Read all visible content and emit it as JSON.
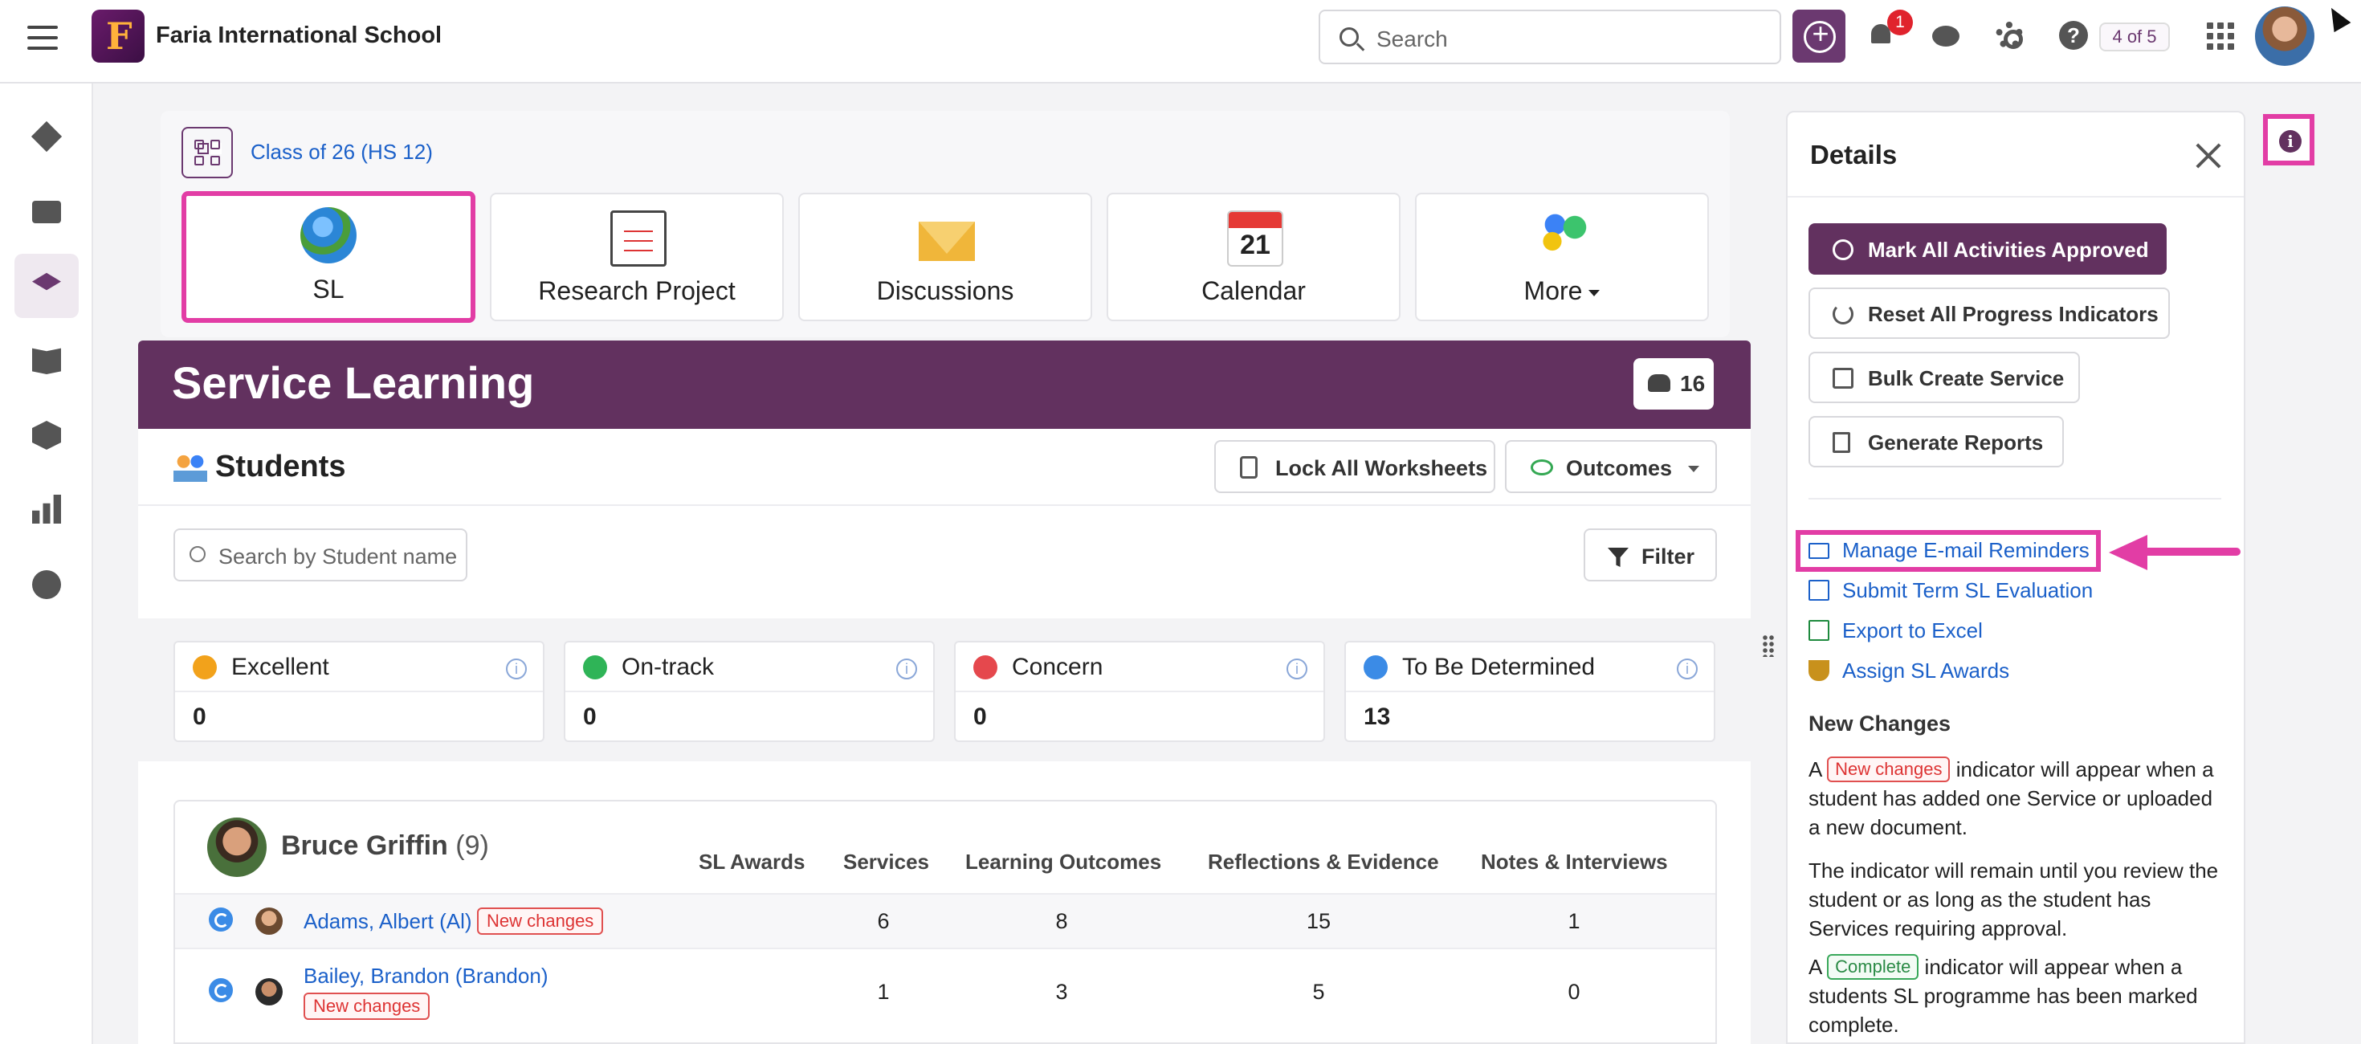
{
  "header": {
    "school_name": "Faria International School",
    "logo_letter": "F",
    "search_placeholder": "Search",
    "notification_count": "1",
    "pager": "4 of 5"
  },
  "classbar": {
    "class_name": "Class of 26 (HS 12)",
    "tiles": [
      {
        "label": "SL",
        "icon": "globe-icon",
        "selected": true
      },
      {
        "label": "Research Project",
        "icon": "clipboard-icon",
        "selected": false
      },
      {
        "label": "Discussions",
        "icon": "envelope-icon",
        "selected": false
      },
      {
        "label": "Calendar",
        "icon": "calendar-icon",
        "selected": false
      },
      {
        "label": "More",
        "icon": "more-apps-icon",
        "selected": false
      }
    ],
    "calendar_day": "21"
  },
  "banner": {
    "title": "Service Learning",
    "student_count": "16",
    "color": "#62315f"
  },
  "students": {
    "title": "Students",
    "lock_label": "Lock All Worksheets",
    "outcomes_label": "Outcomes",
    "search_placeholder": "Search by Student name",
    "filter_label": "Filter"
  },
  "status_cards": [
    {
      "label": "Excellent",
      "value": "0",
      "color": "#f2a21b"
    },
    {
      "label": "On-track",
      "value": "0",
      "color": "#2fb457"
    },
    {
      "label": "Concern",
      "value": "0",
      "color": "#e5484d"
    },
    {
      "label": "To Be Determined",
      "value": "13",
      "color": "#3b8be6"
    }
  ],
  "table": {
    "teacher_name": "Bruce Griffin",
    "teacher_count": "(9)",
    "columns": [
      "SL Awards",
      "Services",
      "Learning Outcomes",
      "Reflections & Evidence",
      "Notes & Interviews"
    ],
    "rows": [
      {
        "name": "Adams, Albert (Al)",
        "tag": "New changes",
        "services": "6",
        "outcomes": "8",
        "reflections": "15",
        "notes": "1"
      },
      {
        "name": "Bailey, Brandon (Brandon)",
        "tag": "New changes",
        "services": "1",
        "outcomes": "3",
        "reflections": "5",
        "notes": "0"
      }
    ]
  },
  "details": {
    "title": "Details",
    "buttons": [
      "Mark All Activities Approved",
      "Reset All Progress Indicators",
      "Bulk Create Service",
      "Generate Reports"
    ],
    "links": [
      "Manage E-mail Reminders",
      "Submit Term SL Evaluation",
      "Export to Excel",
      "Assign SL Awards"
    ],
    "new_changes_title": "New Changes",
    "p1_a": "A",
    "p1_tag": "New changes",
    "p1_b": "indicator will appear when a student has added one Service or uploaded a new document.",
    "p2": "The indicator will remain until you review the student or as long as the student has Services requiring approval.",
    "p3_a": "A",
    "p3_tag": "Complete",
    "p3_b": "indicator will appear when a students SL programme has been marked complete."
  },
  "colors": {
    "accent": "#62315f",
    "highlight": "#e23da5",
    "link": "#1b60c9"
  }
}
